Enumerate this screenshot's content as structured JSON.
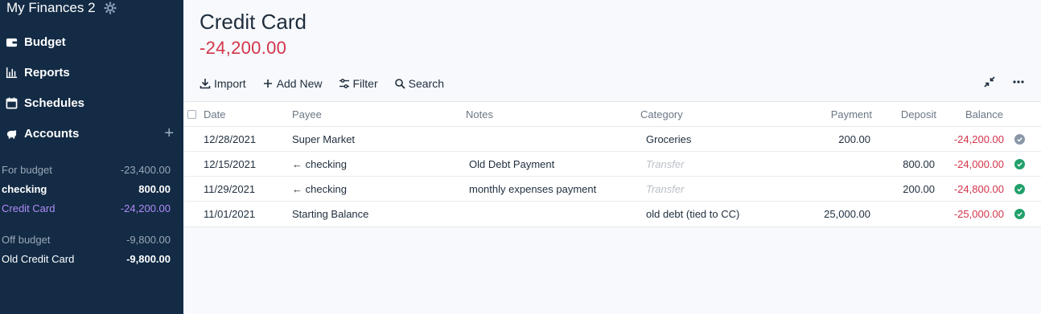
{
  "sidebar": {
    "brand": "My Finances 2",
    "nav": [
      {
        "label": "Budget",
        "icon": "wallet-icon"
      },
      {
        "label": "Reports",
        "icon": "bar-chart-icon"
      },
      {
        "label": "Schedules",
        "icon": "calendar-icon"
      },
      {
        "label": "Accounts",
        "icon": "piggy-bank-icon"
      }
    ],
    "on_budget": {
      "label": "For budget",
      "amount": "-23,400.00"
    },
    "accounts_on": [
      {
        "name": "checking",
        "amount": "800.00"
      },
      {
        "name": "Credit Card",
        "amount": "-24,200.00"
      }
    ],
    "off_budget": {
      "label": "Off budget",
      "amount": "-9,800.00"
    },
    "accounts_off": [
      {
        "name": "Old Credit Card",
        "amount": "-9,800.00"
      }
    ]
  },
  "account": {
    "title": "Credit Card",
    "balance": "-24,200.00"
  },
  "toolbar": {
    "import": "Import",
    "add_new": "Add New",
    "filter": "Filter",
    "search": "Search"
  },
  "table": {
    "headers": {
      "date": "Date",
      "payee": "Payee",
      "notes": "Notes",
      "category": "Category",
      "payment": "Payment",
      "deposit": "Deposit",
      "balance": "Balance"
    },
    "rows": [
      {
        "date": "12/28/2021",
        "payee": "Super Market",
        "notes": "",
        "category": "Groceries",
        "payment": "200.00",
        "deposit": "",
        "balance": "-24,200.00",
        "status": "pending"
      },
      {
        "date": "12/15/2021",
        "payee": "← checking",
        "notes": "Old Debt Payment",
        "category": "Transfer",
        "payment": "",
        "deposit": "800.00",
        "balance": "-24,000.00",
        "status": "cleared"
      },
      {
        "date": "11/29/2021",
        "payee": "← checking",
        "notes": "monthly expenses payment",
        "category": "Transfer",
        "payment": "",
        "deposit": "200.00",
        "balance": "-24,800.00",
        "status": "cleared"
      },
      {
        "date": "11/01/2021",
        "payee": "Starting Balance",
        "notes": "",
        "category": "old debt (tied to CC)",
        "payment": "25,000.00",
        "deposit": "",
        "balance": "-25,000.00",
        "status": "cleared"
      }
    ]
  },
  "colors": {
    "sidebar_bg": "#132b45",
    "accent_purple": "#b08cf7",
    "negative": "#d3344a",
    "cleared": "#22a06b",
    "pending": "#8a96a8"
  }
}
